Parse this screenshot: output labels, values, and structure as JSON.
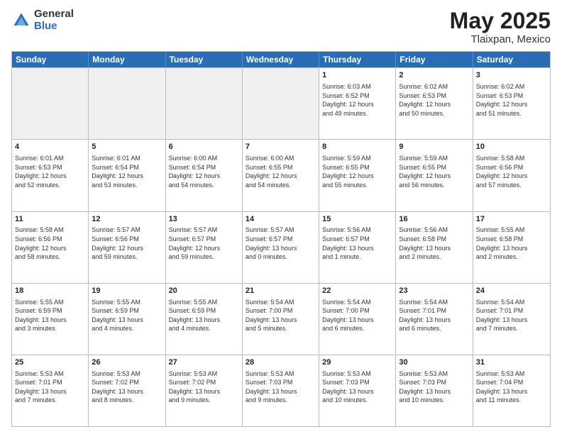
{
  "header": {
    "logo_general": "General",
    "logo_blue": "Blue",
    "title": "May 2025",
    "location": "Tlaixpan, Mexico"
  },
  "days_of_week": [
    "Sunday",
    "Monday",
    "Tuesday",
    "Wednesday",
    "Thursday",
    "Friday",
    "Saturday"
  ],
  "weeks": [
    [
      {
        "day": "",
        "info": "",
        "shaded": true
      },
      {
        "day": "",
        "info": "",
        "shaded": true
      },
      {
        "day": "",
        "info": "",
        "shaded": true
      },
      {
        "day": "",
        "info": "",
        "shaded": true
      },
      {
        "day": "1",
        "info": "Sunrise: 6:03 AM\nSunset: 6:52 PM\nDaylight: 12 hours\nand 49 minutes.",
        "shaded": false
      },
      {
        "day": "2",
        "info": "Sunrise: 6:02 AM\nSunset: 6:53 PM\nDaylight: 12 hours\nand 50 minutes.",
        "shaded": false
      },
      {
        "day": "3",
        "info": "Sunrise: 6:02 AM\nSunset: 6:53 PM\nDaylight: 12 hours\nand 51 minutes.",
        "shaded": false
      }
    ],
    [
      {
        "day": "4",
        "info": "Sunrise: 6:01 AM\nSunset: 6:53 PM\nDaylight: 12 hours\nand 52 minutes.",
        "shaded": false
      },
      {
        "day": "5",
        "info": "Sunrise: 6:01 AM\nSunset: 6:54 PM\nDaylight: 12 hours\nand 53 minutes.",
        "shaded": false
      },
      {
        "day": "6",
        "info": "Sunrise: 6:00 AM\nSunset: 6:54 PM\nDaylight: 12 hours\nand 54 minutes.",
        "shaded": false
      },
      {
        "day": "7",
        "info": "Sunrise: 6:00 AM\nSunset: 6:55 PM\nDaylight: 12 hours\nand 54 minutes.",
        "shaded": false
      },
      {
        "day": "8",
        "info": "Sunrise: 5:59 AM\nSunset: 6:55 PM\nDaylight: 12 hours\nand 55 minutes.",
        "shaded": false
      },
      {
        "day": "9",
        "info": "Sunrise: 5:59 AM\nSunset: 6:55 PM\nDaylight: 12 hours\nand 56 minutes.",
        "shaded": false
      },
      {
        "day": "10",
        "info": "Sunrise: 5:58 AM\nSunset: 6:56 PM\nDaylight: 12 hours\nand 57 minutes.",
        "shaded": false
      }
    ],
    [
      {
        "day": "11",
        "info": "Sunrise: 5:58 AM\nSunset: 6:56 PM\nDaylight: 12 hours\nand 58 minutes.",
        "shaded": false
      },
      {
        "day": "12",
        "info": "Sunrise: 5:57 AM\nSunset: 6:56 PM\nDaylight: 12 hours\nand 59 minutes.",
        "shaded": false
      },
      {
        "day": "13",
        "info": "Sunrise: 5:57 AM\nSunset: 6:57 PM\nDaylight: 12 hours\nand 59 minutes.",
        "shaded": false
      },
      {
        "day": "14",
        "info": "Sunrise: 5:57 AM\nSunset: 6:57 PM\nDaylight: 13 hours\nand 0 minutes.",
        "shaded": false
      },
      {
        "day": "15",
        "info": "Sunrise: 5:56 AM\nSunset: 6:57 PM\nDaylight: 13 hours\nand 1 minute.",
        "shaded": false
      },
      {
        "day": "16",
        "info": "Sunrise: 5:56 AM\nSunset: 6:58 PM\nDaylight: 13 hours\nand 2 minutes.",
        "shaded": false
      },
      {
        "day": "17",
        "info": "Sunrise: 5:55 AM\nSunset: 6:58 PM\nDaylight: 13 hours\nand 2 minutes.",
        "shaded": false
      }
    ],
    [
      {
        "day": "18",
        "info": "Sunrise: 5:55 AM\nSunset: 6:59 PM\nDaylight: 13 hours\nand 3 minutes.",
        "shaded": false
      },
      {
        "day": "19",
        "info": "Sunrise: 5:55 AM\nSunset: 6:59 PM\nDaylight: 13 hours\nand 4 minutes.",
        "shaded": false
      },
      {
        "day": "20",
        "info": "Sunrise: 5:55 AM\nSunset: 6:59 PM\nDaylight: 13 hours\nand 4 minutes.",
        "shaded": false
      },
      {
        "day": "21",
        "info": "Sunrise: 5:54 AM\nSunset: 7:00 PM\nDaylight: 13 hours\nand 5 minutes.",
        "shaded": false
      },
      {
        "day": "22",
        "info": "Sunrise: 5:54 AM\nSunset: 7:00 PM\nDaylight: 13 hours\nand 6 minutes.",
        "shaded": false
      },
      {
        "day": "23",
        "info": "Sunrise: 5:54 AM\nSunset: 7:01 PM\nDaylight: 13 hours\nand 6 minutes.",
        "shaded": false
      },
      {
        "day": "24",
        "info": "Sunrise: 5:54 AM\nSunset: 7:01 PM\nDaylight: 13 hours\nand 7 minutes.",
        "shaded": false
      }
    ],
    [
      {
        "day": "25",
        "info": "Sunrise: 5:53 AM\nSunset: 7:01 PM\nDaylight: 13 hours\nand 7 minutes.",
        "shaded": false
      },
      {
        "day": "26",
        "info": "Sunrise: 5:53 AM\nSunset: 7:02 PM\nDaylight: 13 hours\nand 8 minutes.",
        "shaded": false
      },
      {
        "day": "27",
        "info": "Sunrise: 5:53 AM\nSunset: 7:02 PM\nDaylight: 13 hours\nand 9 minutes.",
        "shaded": false
      },
      {
        "day": "28",
        "info": "Sunrise: 5:53 AM\nSunset: 7:03 PM\nDaylight: 13 hours\nand 9 minutes.",
        "shaded": false
      },
      {
        "day": "29",
        "info": "Sunrise: 5:53 AM\nSunset: 7:03 PM\nDaylight: 13 hours\nand 10 minutes.",
        "shaded": false
      },
      {
        "day": "30",
        "info": "Sunrise: 5:53 AM\nSunset: 7:03 PM\nDaylight: 13 hours\nand 10 minutes.",
        "shaded": false
      },
      {
        "day": "31",
        "info": "Sunrise: 5:53 AM\nSunset: 7:04 PM\nDaylight: 13 hours\nand 11 minutes.",
        "shaded": false
      }
    ]
  ]
}
